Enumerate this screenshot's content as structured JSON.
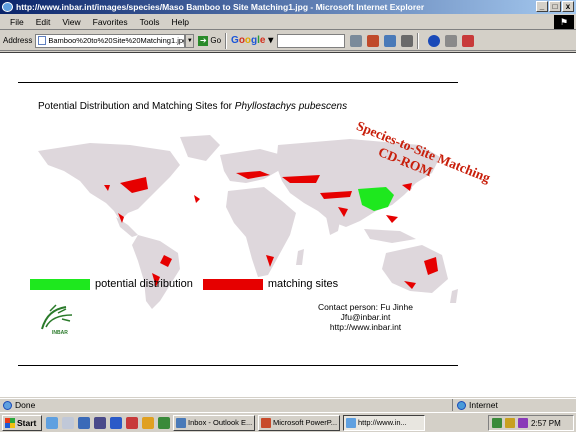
{
  "window": {
    "title": "http://www.inbar.int/images/species/Maso Bamboo to Site Matching1.jpg - Microsoft Internet Explorer",
    "minimize": "_",
    "maximize": "□",
    "close": "x"
  },
  "menu": {
    "items": [
      "File",
      "Edit",
      "View",
      "Favorites",
      "Tools",
      "Help"
    ]
  },
  "address": {
    "label": "Address",
    "value": "Bamboo%20to%20Site%20Matching1.jpg",
    "go": "Go"
  },
  "google": {
    "letters": [
      "G",
      "o",
      "o",
      "g",
      "l",
      "e"
    ],
    "dropdown": "▾"
  },
  "figure": {
    "title_prefix": "Potential Distribution and Matching Sites for ",
    "title_species": "Phyllostachys pubescens",
    "legend": {
      "potential": "potential distribution",
      "matching": "matching sites",
      "potential_color": "#1ee81e",
      "matching_color": "#e60000"
    },
    "contact": {
      "line1": "Contact person: Fu Jinhe",
      "line2": "Jfu@inbar.int",
      "line3": "http://www.inbar.int"
    },
    "logo_text": "INBAR",
    "stamp": {
      "line1": "Species-to-Site Matching",
      "line2": "CD-ROM",
      "color": "#c81e0a"
    },
    "land_color": "#ded7dc"
  },
  "status": {
    "left": "Done",
    "zone": "Internet"
  },
  "taskbar": {
    "start": "Start",
    "tasks": [
      {
        "label": "Inbox - Outlook E..."
      },
      {
        "label": "Microsoft PowerP..."
      },
      {
        "label": "http://www.in..."
      }
    ],
    "clock": "2:57 PM"
  }
}
